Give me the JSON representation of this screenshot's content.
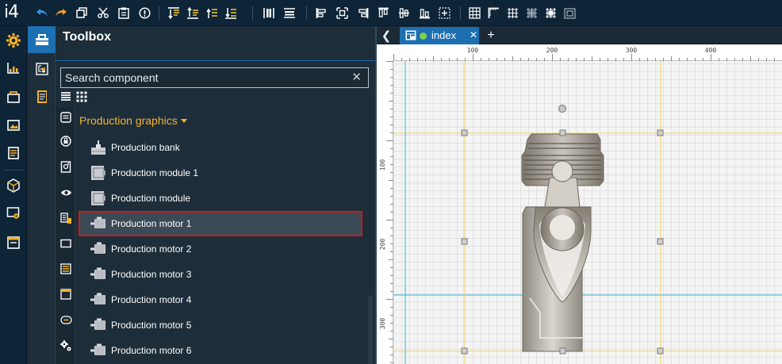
{
  "app": {
    "logo": "i4"
  },
  "toolbar": {
    "buttons": [
      "undo-icon",
      "redo-icon",
      "copy-icon",
      "cut-icon",
      "paste-icon",
      "info-icon",
      "align-top-icon",
      "align-bottom-icon",
      "bring-forward-icon",
      "send-backward-icon",
      "distribute-vertical-icon",
      "distribute-horizontal-icon",
      "align-left-icon",
      "align-center-icon",
      "align-right-icon",
      "align-top-edge-icon",
      "align-middle-icon",
      "align-bottom-edge-icon",
      "center-selection-icon",
      "grid-icon",
      "ruler-icon",
      "snap-grid-icon",
      "snap-objects-icon",
      "grid-settings-icon",
      "fit-icon"
    ]
  },
  "left_menu": [
    "settings-icon",
    "dashboard-icon",
    "project-icon",
    "gallery-icon",
    "pages-icon",
    "packages-icon",
    "screen-settings-icon",
    "window-icon"
  ],
  "panel": {
    "title": "Toolbox",
    "search_placeholder": "Search component",
    "clear_symbol": "✕",
    "group_label": "Production graphics",
    "items": [
      {
        "label": "Production bank",
        "icon": "production-bank-icon"
      },
      {
        "label": "Production module 1",
        "icon": "production-module-icon"
      },
      {
        "label": "Production module",
        "icon": "production-module-icon"
      },
      {
        "label": "Production motor 1",
        "icon": "motor-icon",
        "selected": true
      },
      {
        "label": "Production motor 2",
        "icon": "motor-icon"
      },
      {
        "label": "Production motor 3",
        "icon": "motor-icon"
      },
      {
        "label": "Production motor 4",
        "icon": "motor-icon"
      },
      {
        "label": "Production motor 5",
        "icon": "motor-icon"
      },
      {
        "label": "Production motor 6",
        "icon": "motor-icon"
      }
    ]
  },
  "editor": {
    "back_symbol": "❮",
    "tab": {
      "label": "index",
      "close": "✕",
      "status_color": "#7bd24b"
    },
    "add_symbol": "+",
    "ruler": {
      "h_labels": [
        "100",
        "200",
        "300",
        "400"
      ],
      "v_labels": [
        "100",
        "200",
        "300"
      ]
    }
  },
  "colors": {
    "accent": "#1d6fb2",
    "group_header": "#f0b43a",
    "selection_outline": "#d21818",
    "guide_yellow": "#f3d54a",
    "guide_cyan": "#30b3d6"
  }
}
